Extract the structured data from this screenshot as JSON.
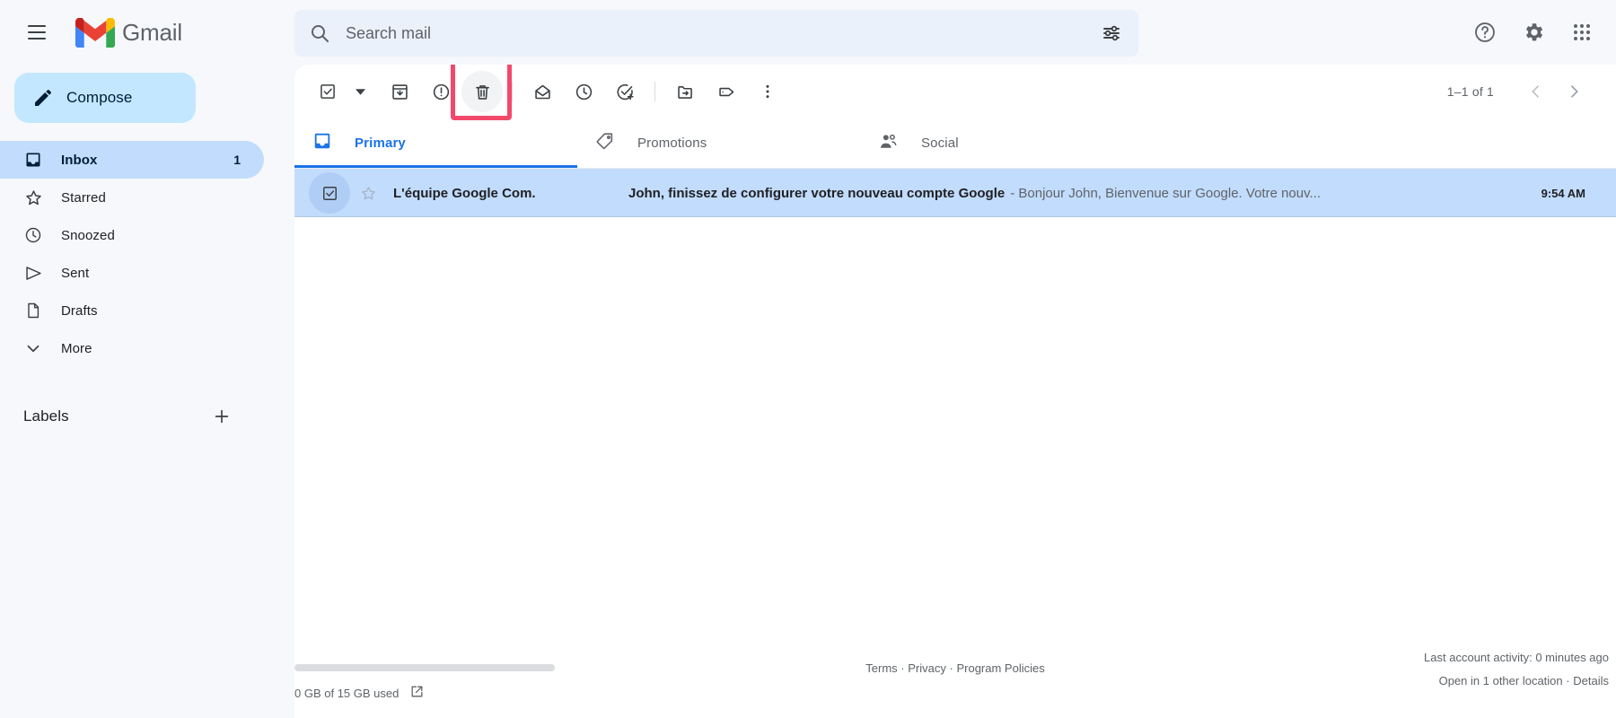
{
  "header": {
    "menu_icon": "hamburger-menu-icon",
    "logo_icon": "gmail-logo-icon",
    "logo_text": "Gmail",
    "help_icon": "help-circle-icon",
    "settings_icon": "gear-icon",
    "apps_icon": "google-apps-grid-icon"
  },
  "search": {
    "icon": "search-icon",
    "placeholder": "Search mail",
    "value": "",
    "options_icon": "search-options-sliders-icon"
  },
  "sidebar": {
    "compose": {
      "label": "Compose",
      "icon": "pencil-icon"
    },
    "items": [
      {
        "label": "Inbox",
        "icon": "inbox-icon",
        "count": "1",
        "active": true
      },
      {
        "label": "Starred",
        "icon": "star-icon",
        "count": "",
        "active": false
      },
      {
        "label": "Snoozed",
        "icon": "clock-icon",
        "count": "",
        "active": false
      },
      {
        "label": "Sent",
        "icon": "send-icon",
        "count": "",
        "active": false
      },
      {
        "label": "Drafts",
        "icon": "document-icon",
        "count": "",
        "active": false
      },
      {
        "label": "More",
        "icon": "chevron-down-icon",
        "count": "",
        "active": false
      }
    ],
    "labels": {
      "title": "Labels",
      "add_icon": "plus-icon"
    }
  },
  "toolbar": {
    "select_all_icon": "checkbox-checked-icon",
    "select_caret_icon": "caret-down-icon",
    "archive_icon": "archive-icon",
    "spam_icon": "report-spam-icon",
    "delete_icon": "trash-delete-icon",
    "delete_highlight_color": "#F2496B",
    "mark_read_icon": "open-envelope-icon",
    "snooze_icon": "clock-snooze-icon",
    "add_task_icon": "add-to-tasks-icon",
    "move_to_icon": "move-to-folder-icon",
    "labels_icon": "label-tag-icon",
    "more_icon": "more-vertical-icon",
    "pager_text": "1–1 of 1",
    "prev_icon": "chevron-left-icon",
    "next_icon": "chevron-right-icon"
  },
  "tabs": [
    {
      "label": "Primary",
      "icon": "inbox-tab-icon",
      "active": true
    },
    {
      "label": "Promotions",
      "icon": "tag-tab-icon",
      "active": false
    },
    {
      "label": "Social",
      "icon": "people-tab-icon",
      "active": false
    }
  ],
  "emails": [
    {
      "sender": "L'équipe Google Com.",
      "subject": "John, finissez de configurer votre nouveau compte Google",
      "snippet": "- Bonjour John, Bienvenue sur Google. Votre nouv...",
      "time": "9:54 AM",
      "selected": true,
      "starred": false,
      "checkbox_icon": "checkbox-checked-icon",
      "star_icon": "star-outline-icon"
    }
  ],
  "footer": {
    "storage_text": "0 GB of 15 GB used",
    "storage_external_icon": "open-in-new-icon",
    "storage_percent": 0,
    "links": [
      {
        "label": "Terms"
      },
      {
        "label": "Privacy"
      },
      {
        "label": "Program Policies"
      }
    ],
    "link_separator": "·",
    "account_activity": "Last account activity: 0 minutes ago",
    "open_locations": "Open in 1 other location",
    "details_label": "Details",
    "details_separator": "·"
  },
  "colors": {
    "accent_blue": "#1A73E8",
    "selected_row": "#C2DCFD",
    "compose_bg": "#C2E7FF",
    "highlight_pink": "#F2496B",
    "panel_bg": "#FFFFFF",
    "app_bg": "#F6F8FC"
  }
}
